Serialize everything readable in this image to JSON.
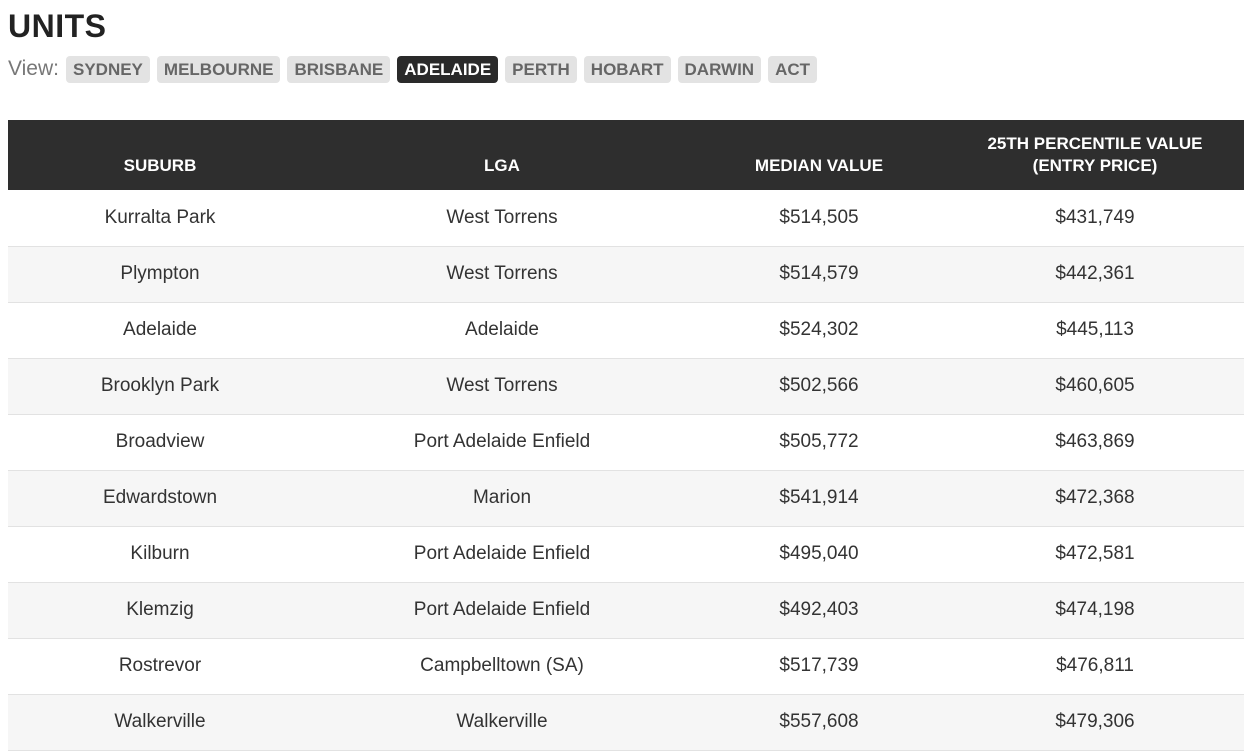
{
  "page": {
    "title": "UNITS"
  },
  "view": {
    "label": "View:",
    "tabs": [
      {
        "label": "SYDNEY",
        "active": false
      },
      {
        "label": "MELBOURNE",
        "active": false
      },
      {
        "label": "BRISBANE",
        "active": false
      },
      {
        "label": "ADELAIDE",
        "active": true
      },
      {
        "label": "PERTH",
        "active": false
      },
      {
        "label": "HOBART",
        "active": false
      },
      {
        "label": "DARWIN",
        "active": false
      },
      {
        "label": "ACT",
        "active": false
      }
    ]
  },
  "table": {
    "headers": {
      "suburb": "SUBURB",
      "lga": "LGA",
      "median": "MEDIAN VALUE",
      "entry_line1": "25TH PERCENTILE VALUE",
      "entry_line2": "(ENTRY PRICE)"
    },
    "rows": [
      {
        "suburb": "Kurralta Park",
        "lga": "West Torrens",
        "median": "$514,505",
        "entry": "$431,749"
      },
      {
        "suburb": "Plympton",
        "lga": "West Torrens",
        "median": "$514,579",
        "entry": "$442,361"
      },
      {
        "suburb": "Adelaide",
        "lga": "Adelaide",
        "median": "$524,302",
        "entry": "$445,113"
      },
      {
        "suburb": "Brooklyn Park",
        "lga": "West Torrens",
        "median": "$502,566",
        "entry": "$460,605"
      },
      {
        "suburb": "Broadview",
        "lga": "Port Adelaide Enfield",
        "median": "$505,772",
        "entry": "$463,869"
      },
      {
        "suburb": "Edwardstown",
        "lga": "Marion",
        "median": "$541,914",
        "entry": "$472,368"
      },
      {
        "suburb": "Kilburn",
        "lga": "Port Adelaide Enfield",
        "median": "$495,040",
        "entry": "$472,581"
      },
      {
        "suburb": "Klemzig",
        "lga": "Port Adelaide Enfield",
        "median": "$492,403",
        "entry": "$474,198"
      },
      {
        "suburb": "Rostrevor",
        "lga": "Campbelltown (SA)",
        "median": "$517,739",
        "entry": "$476,811"
      },
      {
        "suburb": "Walkerville",
        "lga": "Walkerville",
        "median": "$557,608",
        "entry": "$479,306"
      }
    ]
  },
  "colors": {
    "header_bg": "#2e2e2e",
    "active_tab_bg": "#2a2a2a",
    "inactive_tab_bg": "#e3e3e3",
    "stripe_bg": "#f6f6f6"
  }
}
